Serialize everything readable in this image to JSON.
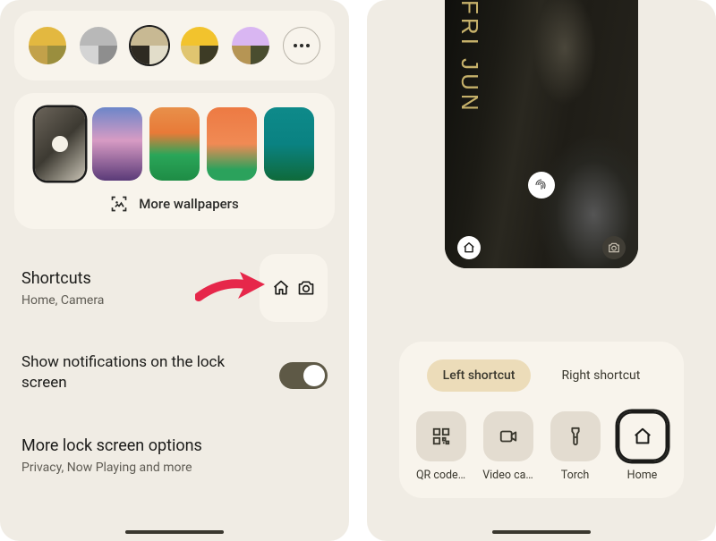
{
  "left": {
    "color_swatches": [
      {
        "top": "#e3b840",
        "bl": "#c2a14a",
        "br": "#9a8e3e",
        "selected": false
      },
      {
        "top": "#b8b8b8",
        "bl": "#d4d4d4",
        "br": "#8e8e8e",
        "selected": false
      },
      {
        "top": "#c8b993",
        "bl": "#2e2a22",
        "br": "#e2ddca",
        "selected": true
      },
      {
        "top": "#f2c32d",
        "bl": "#e0c570",
        "br": "#3d3b25",
        "selected": false
      },
      {
        "top": "#d9b6f2",
        "bl": "#b69554",
        "br": "#4a4d2f",
        "selected": false
      }
    ],
    "wallpapers": [
      {
        "bg": "linear-gradient(135deg,#6b645a 0%, #3d3a32 50%, #c9c3b5 100%)",
        "selected": true
      },
      {
        "bg": "linear-gradient(180deg,#6c86c9 0%, #d79bc4 45%, #5a3a78 100%)",
        "selected": false
      },
      {
        "bg": "linear-gradient(180deg,#e8904a 0%, #e87a38 35%, #2aa659 65%, #1e8c45 100%)",
        "selected": false
      },
      {
        "bg": "linear-gradient(180deg,#ed7a43 0%, #f08a54 50%, #2ba25c 85%)",
        "selected": false
      },
      {
        "bg": "linear-gradient(180deg,#0e8a8a 0%, #0a8282 50%, #0f6a3a 100%)",
        "selected": false
      }
    ],
    "more_wallpapers": "More wallpapers",
    "shortcuts": {
      "title": "Shortcuts",
      "sub": "Home, Camera"
    },
    "notifications_row": "Show notifications on the lock screen",
    "more_options": {
      "title": "More lock screen options",
      "sub": "Privacy, Now Playing and more"
    }
  },
  "right": {
    "date_text": "FRI JUN",
    "tabs": {
      "left": "Left shortcut",
      "right": "Right shortcut",
      "active": "left"
    },
    "options": [
      {
        "id": "qr",
        "label": "QR code…",
        "icon": "qr"
      },
      {
        "id": "video",
        "label": "Video ca…",
        "icon": "video"
      },
      {
        "id": "torch",
        "label": "Torch",
        "icon": "torch"
      },
      {
        "id": "home",
        "label": "Home",
        "icon": "home",
        "selected": true
      }
    ]
  }
}
